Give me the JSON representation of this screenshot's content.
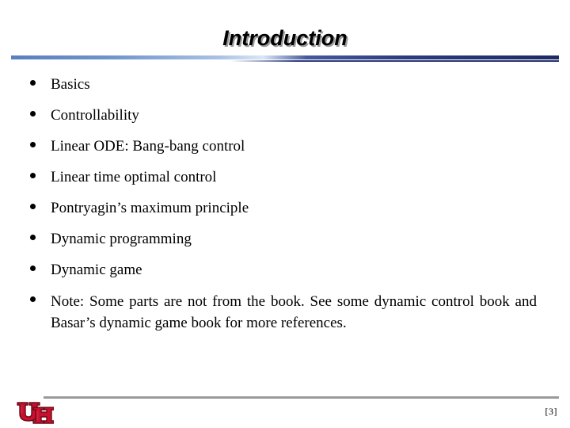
{
  "slide": {
    "title": "Introduction",
    "background_color": "#ffffff",
    "title_shadow_color": "#9a9a9a",
    "divider_colors": {
      "left": "#5b7fbe",
      "highlight": "#dbe6f4",
      "right": "#1e2a63"
    },
    "bullets": [
      {
        "text": "Basics",
        "marker": "bullet-dot"
      },
      {
        "text": "Controllability",
        "marker": "bullet-dot"
      },
      {
        "text": "Linear ODE: Bang-bang control",
        "marker": "bullet-dot"
      },
      {
        "text": "Linear time optimal control",
        "marker": "bullet-dot"
      },
      {
        "text": "Pontryagin’s maximum principle",
        "marker": "bullet-dot"
      },
      {
        "text": "Dynamic programming",
        "marker": "bullet-dot"
      },
      {
        "text": "Dynamic game",
        "marker": "bullet-dot"
      },
      {
        "text": "Note: Some parts are not from the book. See some dynamic control book and Basar’s dynamic game book for more references.",
        "marker": "bullet-dot"
      }
    ],
    "footer": {
      "logo_name": "university-of-houston-logo",
      "logo_text": "UH",
      "logo_color": "#c8102e",
      "logo_outline_color": "#7a0a1c",
      "rule_color": "#9a9a9a",
      "page_number": "[3]"
    }
  }
}
